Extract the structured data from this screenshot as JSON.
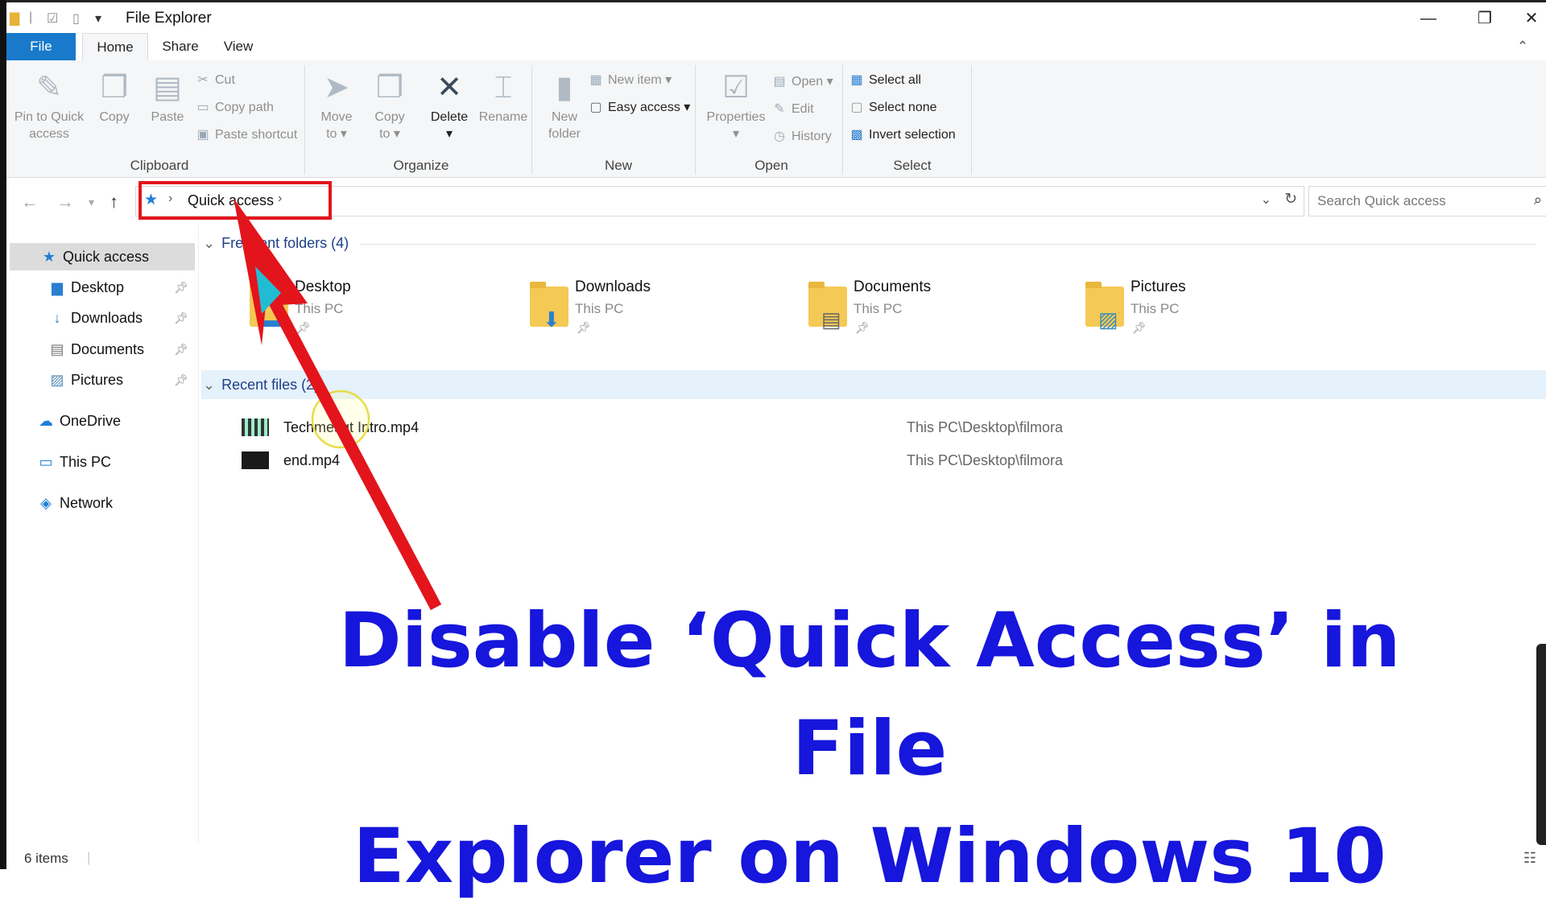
{
  "window": {
    "title": "File Explorer",
    "controls": {
      "minimize": "—",
      "restore": "❐",
      "close": "✕"
    }
  },
  "ribbon_tabs": [
    {
      "label": "File"
    },
    {
      "label": "Home"
    },
    {
      "label": "Share"
    },
    {
      "label": "View"
    }
  ],
  "ribbon": {
    "clipboard": {
      "group_label": "Clipboard",
      "pin_line1": "Pin to Quick",
      "pin_line2": "access",
      "copy": "Copy",
      "paste": "Paste",
      "cut": "Cut",
      "copy_path": "Copy path",
      "paste_shortcut": "Paste shortcut"
    },
    "organize": {
      "group_label": "Organize",
      "move_line1": "Move",
      "move_line2": "to ▾",
      "copy_line1": "Copy",
      "copy_line2": "to ▾",
      "delete_line1": "Delete",
      "delete_line2": "▾",
      "rename": "Rename"
    },
    "new": {
      "group_label": "New",
      "new_folder_line1": "New",
      "new_folder_line2": "folder",
      "new_item": "New item ▾",
      "easy_access": "Easy access ▾"
    },
    "open": {
      "group_label": "Open",
      "properties_line1": "Properties",
      "properties_line2": "▾",
      "open": "Open ▾",
      "edit": "Edit",
      "history": "History"
    },
    "select": {
      "group_label": "Select",
      "select_all": "Select all",
      "select_none": "Select none",
      "invert": "Invert selection"
    }
  },
  "address": {
    "segment": "Quick access",
    "search_placeholder": "Search Quick access"
  },
  "nav_pane": [
    {
      "label": "Quick access",
      "icon": "★"
    },
    {
      "label": "Desktop",
      "icon": "▆"
    },
    {
      "label": "Downloads",
      "icon": "↓"
    },
    {
      "label": "Documents",
      "icon": "▤"
    },
    {
      "label": "Pictures",
      "icon": "▨"
    },
    {
      "label": "OneDrive",
      "icon": "☁"
    },
    {
      "label": "This PC",
      "icon": "▭"
    },
    {
      "label": "Network",
      "icon": "◈"
    }
  ],
  "frequent": {
    "header": "Frequent folders (4)",
    "folders": [
      {
        "name": "Desktop",
        "location": "This PC"
      },
      {
        "name": "Downloads",
        "location": "This PC"
      },
      {
        "name": "Documents",
        "location": "This PC"
      },
      {
        "name": "Pictures",
        "location": "This PC"
      }
    ]
  },
  "recent": {
    "header": "Recent files (2)",
    "files": [
      {
        "name": "Techmesgt Intro.mp4",
        "path": "This PC\\Desktop\\filmora"
      },
      {
        "name": "end.mp4",
        "path": "This PC\\Desktop\\filmora"
      }
    ]
  },
  "status": {
    "items": "6 items"
  },
  "overlay": {
    "caption_line1": "Disable ‘Quick Access’ in File",
    "caption_line2": "Explorer on Windows 10",
    "arrow_color": "#e3141c",
    "highlight_color": "#e3141c"
  }
}
